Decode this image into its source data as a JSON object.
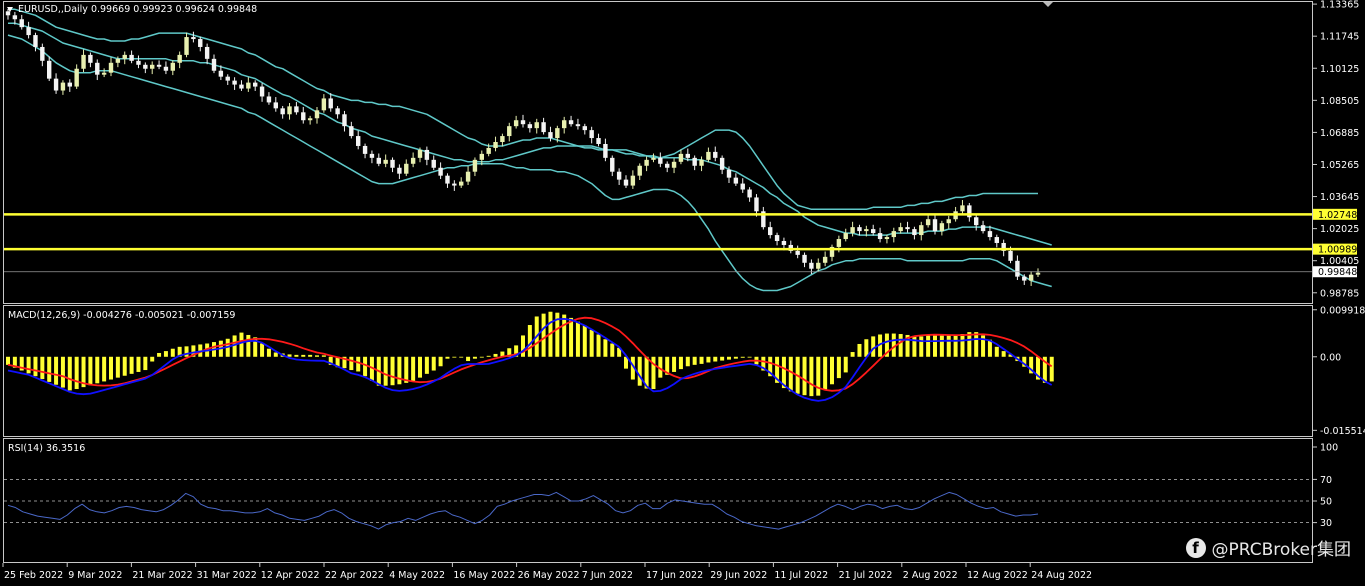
{
  "header": {
    "symbol_line": "EURUSD,,Daily  0.99669 0.99923 0.99624 0.99848"
  },
  "colors": {
    "background": "#000000",
    "frame": "#c8c8c8",
    "bull_candle": "#e8f0b0",
    "bear_candle": "#f4f4f4",
    "bollinger": "#5fc8c8",
    "level_line": "#ffff33",
    "macd_hist": "#ffff33",
    "macd_main": "#1010ff",
    "macd_signal": "#ff1a1a",
    "rsi_line": "#4a68c8"
  },
  "watermark": {
    "icon": "facebook-icon",
    "text": "@PRCBroker集团"
  },
  "chart_data": [
    {
      "type": "candlestick",
      "title": "EURUSD,,Daily",
      "indicators": [
        "Bollinger Bands"
      ],
      "last_ohlc": {
        "open": 0.99669,
        "high": 0.99923,
        "low": 0.99624,
        "close": 0.99848
      },
      "y_ticks": [
        "1.13365",
        "1.11745",
        "1.10125",
        "1.08505",
        "1.06885",
        "1.05265",
        "1.03645",
        "1.02025",
        "1.00405",
        "0.98785"
      ],
      "ylim": [
        0.9837,
        1.1337
      ],
      "x_tick_labels": [
        "25 Feb 2022",
        "9 Mar 2022",
        "21 Mar 2022",
        "31 Mar 2022",
        "12 Apr 2022",
        "22 Apr 2022",
        "4 May 2022",
        "16 May 2022",
        "26 May 2022",
        "7 Jun 2022",
        "17 Jun 2022",
        "29 Jun 2022",
        "11 Jul 2022",
        "21 Jul 2022",
        "2 Aug 2022",
        "12 Aug 2022",
        "24 Aug 2022"
      ],
      "horizontal_levels": [
        {
          "value": 1.02748,
          "label": "1.02748"
        },
        {
          "value": 1.00989,
          "label": "1.00989"
        }
      ],
      "current_price": {
        "value": 0.99848,
        "label": "0.99848"
      },
      "closes": [
        1.128,
        1.126,
        1.122,
        1.118,
        1.112,
        1.105,
        1.096,
        1.09,
        1.094,
        1.092,
        1.101,
        1.108,
        1.104,
        1.098,
        1.099,
        1.104,
        1.106,
        1.108,
        1.105,
        1.103,
        1.101,
        1.103,
        1.102,
        1.1,
        1.104,
        1.108,
        1.117,
        1.116,
        1.112,
        1.106,
        1.1,
        1.097,
        1.095,
        1.093,
        1.091,
        1.094,
        1.092,
        1.087,
        1.084,
        1.081,
        1.078,
        1.082,
        1.079,
        1.075,
        1.076,
        1.08,
        1.086,
        1.081,
        1.078,
        1.072,
        1.067,
        1.062,
        1.058,
        1.056,
        1.053,
        1.055,
        1.051,
        1.048,
        1.053,
        1.056,
        1.06,
        1.055,
        1.051,
        1.047,
        1.043,
        1.042,
        1.044,
        1.049,
        1.055,
        1.058,
        1.061,
        1.064,
        1.067,
        1.072,
        1.075,
        1.073,
        1.071,
        1.074,
        1.069,
        1.066,
        1.071,
        1.075,
        1.073,
        1.072,
        1.07,
        1.066,
        1.063,
        1.056,
        1.049,
        1.045,
        1.042,
        1.047,
        1.052,
        1.055,
        1.056,
        1.053,
        1.051,
        1.054,
        1.058,
        1.056,
        1.052,
        1.055,
        1.059,
        1.056,
        1.05,
        1.046,
        1.043,
        1.04,
        1.036,
        1.029,
        1.021,
        1.017,
        1.014,
        1.012,
        1.009,
        1.007,
        1.003,
        1.0,
        1.003,
        1.006,
        1.011,
        1.015,
        1.018,
        1.021,
        1.019,
        1.02,
        1.018,
        1.015,
        1.016,
        1.019,
        1.021,
        1.02,
        1.017,
        1.022,
        1.025,
        1.019,
        1.023,
        1.025,
        1.029,
        1.032,
        1.026,
        1.022,
        1.019,
        1.016,
        1.013,
        1.009,
        1.004,
        0.996,
        0.994,
        0.997,
        0.998
      ],
      "bollinger": {
        "upper": [
          1.131,
          1.131,
          1.13,
          1.129,
          1.128,
          1.126,
          1.124,
          1.122,
          1.121,
          1.12,
          1.119,
          1.118,
          1.117,
          1.116,
          1.116,
          1.115,
          1.115,
          1.115,
          1.116,
          1.116,
          1.117,
          1.118,
          1.119,
          1.119,
          1.119,
          1.119,
          1.119,
          1.118,
          1.117,
          1.116,
          1.115,
          1.114,
          1.113,
          1.112,
          1.111,
          1.109,
          1.108,
          1.106,
          1.104,
          1.102,
          1.101,
          1.099,
          1.097,
          1.095,
          1.093,
          1.091,
          1.09,
          1.088,
          1.087,
          1.086,
          1.085,
          1.085,
          1.084,
          1.084,
          1.083,
          1.083,
          1.082,
          1.082,
          1.081,
          1.08,
          1.079,
          1.078,
          1.076,
          1.074,
          1.072,
          1.07,
          1.068,
          1.066,
          1.065,
          1.063,
          1.062,
          1.062,
          1.062,
          1.063,
          1.064,
          1.065,
          1.065,
          1.066,
          1.066,
          1.066,
          1.065,
          1.064,
          1.063,
          1.062,
          1.061,
          1.061,
          1.06,
          1.06,
          1.06,
          1.06,
          1.06,
          1.059,
          1.058,
          1.057,
          1.056,
          1.056,
          1.057,
          1.058,
          1.06,
          1.062,
          1.064,
          1.066,
          1.068,
          1.07,
          1.07,
          1.07,
          1.069,
          1.066,
          1.062,
          1.057,
          1.052,
          1.047,
          1.042,
          1.038,
          1.035,
          1.032,
          1.031,
          1.03,
          1.03,
          1.03,
          1.03,
          1.03,
          1.03,
          1.03,
          1.03,
          1.03,
          1.031,
          1.031,
          1.031,
          1.031,
          1.031,
          1.032,
          1.032,
          1.033,
          1.033,
          1.034,
          1.034,
          1.035,
          1.036,
          1.036,
          1.037,
          1.037,
          1.038,
          1.038,
          1.038,
          1.038,
          1.038,
          1.038,
          1.038,
          1.038,
          1.038
        ],
        "middle": [
          1.124,
          1.124,
          1.123,
          1.122,
          1.121,
          1.12,
          1.118,
          1.116,
          1.114,
          1.113,
          1.112,
          1.111,
          1.11,
          1.109,
          1.108,
          1.107,
          1.106,
          1.106,
          1.106,
          1.106,
          1.106,
          1.106,
          1.106,
          1.106,
          1.105,
          1.105,
          1.105,
          1.105,
          1.104,
          1.104,
          1.103,
          1.102,
          1.101,
          1.1,
          1.098,
          1.097,
          1.096,
          1.094,
          1.092,
          1.09,
          1.088,
          1.087,
          1.085,
          1.083,
          1.081,
          1.079,
          1.078,
          1.076,
          1.074,
          1.073,
          1.071,
          1.07,
          1.069,
          1.067,
          1.066,
          1.065,
          1.064,
          1.063,
          1.062,
          1.061,
          1.06,
          1.059,
          1.058,
          1.057,
          1.056,
          1.055,
          1.055,
          1.054,
          1.054,
          1.054,
          1.054,
          1.055,
          1.055,
          1.056,
          1.057,
          1.058,
          1.059,
          1.06,
          1.061,
          1.061,
          1.062,
          1.062,
          1.062,
          1.062,
          1.062,
          1.062,
          1.061,
          1.06,
          1.06,
          1.059,
          1.058,
          1.058,
          1.057,
          1.057,
          1.057,
          1.056,
          1.056,
          1.056,
          1.056,
          1.055,
          1.055,
          1.055,
          1.054,
          1.053,
          1.052,
          1.05,
          1.049,
          1.047,
          1.045,
          1.043,
          1.041,
          1.038,
          1.036,
          1.033,
          1.031,
          1.029,
          1.026,
          1.024,
          1.022,
          1.021,
          1.02,
          1.019,
          1.018,
          1.018,
          1.017,
          1.017,
          1.017,
          1.017,
          1.017,
          1.018,
          1.018,
          1.018,
          1.018,
          1.018,
          1.019,
          1.019,
          1.019,
          1.02,
          1.02,
          1.021,
          1.021,
          1.021,
          1.021,
          1.021,
          1.02,
          1.019,
          1.018,
          1.017,
          1.016,
          1.015,
          1.014,
          1.013,
          1.012
        ],
        "lower": [
          1.118,
          1.117,
          1.116,
          1.114,
          1.112,
          1.11,
          1.107,
          1.104,
          1.102,
          1.1,
          1.099,
          1.099,
          1.099,
          1.1,
          1.1,
          1.1,
          1.099,
          1.098,
          1.097,
          1.096,
          1.095,
          1.094,
          1.093,
          1.092,
          1.091,
          1.09,
          1.089,
          1.088,
          1.087,
          1.086,
          1.085,
          1.084,
          1.083,
          1.082,
          1.081,
          1.079,
          1.078,
          1.076,
          1.074,
          1.072,
          1.07,
          1.068,
          1.066,
          1.064,
          1.062,
          1.06,
          1.058,
          1.056,
          1.054,
          1.052,
          1.05,
          1.048,
          1.046,
          1.044,
          1.043,
          1.043,
          1.043,
          1.044,
          1.045,
          1.046,
          1.047,
          1.048,
          1.049,
          1.05,
          1.051,
          1.051,
          1.052,
          1.052,
          1.053,
          1.053,
          1.053,
          1.053,
          1.053,
          1.052,
          1.051,
          1.051,
          1.05,
          1.05,
          1.05,
          1.05,
          1.049,
          1.049,
          1.048,
          1.047,
          1.045,
          1.043,
          1.04,
          1.037,
          1.035,
          1.035,
          1.036,
          1.037,
          1.038,
          1.039,
          1.04,
          1.04,
          1.04,
          1.039,
          1.037,
          1.034,
          1.03,
          1.025,
          1.02,
          1.014,
          1.009,
          1.004,
          0.999,
          0.995,
          0.992,
          0.99,
          0.989,
          0.989,
          0.989,
          0.99,
          0.991,
          0.993,
          0.995,
          0.997,
          0.999,
          1.0,
          1.002,
          1.003,
          1.004,
          1.004,
          1.005,
          1.005,
          1.005,
          1.005,
          1.005,
          1.005,
          1.005,
          1.004,
          1.004,
          1.004,
          1.004,
          1.004,
          1.004,
          1.004,
          1.004,
          1.004,
          1.005,
          1.005,
          1.005,
          1.005,
          1.004,
          1.002,
          1.0,
          0.998,
          0.996,
          0.994,
          0.993,
          0.992,
          0.991
        ]
      }
    },
    {
      "type": "macd",
      "title": "MACD(12,26,9)",
      "values_line": "MACD(12,26,9) -0.004276 -0.005021 -0.007159",
      "y_ticks": [
        "0.009918",
        "0.00",
        "-0.015514"
      ],
      "ylim": [
        -0.0165,
        0.0105
      ],
      "histogram": [
        -0.0017,
        -0.0023,
        -0.0029,
        -0.0035,
        -0.0041,
        -0.0047,
        -0.0053,
        -0.0059,
        -0.0065,
        -0.0071,
        -0.0068,
        -0.0064,
        -0.006,
        -0.0056,
        -0.0052,
        -0.0048,
        -0.0044,
        -0.004,
        -0.0036,
        -0.0032,
        -0.0028,
        -0.001,
        0.0008,
        0.0012,
        0.0017,
        0.0021,
        0.0022,
        0.0024,
        0.0026,
        0.0028,
        0.0031,
        0.0034,
        0.0038,
        0.0045,
        0.0051,
        0.0046,
        0.0041,
        0.0028,
        0.0017,
        0.0009,
        0.0007,
        0.0005,
        0.0004,
        0.0004,
        0.0004,
        0.0003,
        0.0003,
        -0.0017,
        -0.0022,
        -0.0024,
        -0.0028,
        -0.0031,
        -0.0041,
        -0.0051,
        -0.0061,
        -0.0061,
        -0.006,
        -0.0058,
        -0.0055,
        -0.0051,
        -0.0044,
        -0.0036,
        -0.0029,
        -0.002,
        -0.0004,
        0.0,
        0.0,
        -0.0009,
        -0.0004,
        -0.0001,
        0.0002,
        0.0006,
        0.0011,
        0.0018,
        0.0024,
        0.0045,
        0.0067,
        0.0085,
        0.0091,
        0.0095,
        0.0093,
        0.0089,
        0.0082,
        0.0074,
        0.0066,
        0.0057,
        0.0047,
        0.0037,
        0.0028,
        0.0019,
        -0.0025,
        -0.0048,
        -0.0061,
        -0.0067,
        -0.0068,
        -0.0044,
        -0.0038,
        -0.0032,
        -0.0026,
        -0.002,
        -0.0017,
        -0.0015,
        -0.0012,
        -0.001,
        -0.0008,
        -0.0006,
        -0.0004,
        -0.0002,
        0.0,
        -0.0016,
        -0.0029,
        -0.0041,
        -0.0055,
        -0.0066,
        -0.0073,
        -0.0078,
        -0.0081,
        -0.0083,
        -0.0082,
        -0.007,
        -0.0058,
        -0.0045,
        -0.0033,
        0.001,
        0.0027,
        0.0037,
        0.0043,
        0.0047,
        0.0049,
        0.0049,
        0.0048,
        0.0046,
        0.0044,
        0.0043,
        0.0047,
        0.0046,
        0.0046,
        0.0045,
        0.0046,
        0.0048,
        0.0052,
        0.0052,
        0.0045,
        0.0036,
        0.0021,
        0.0012,
        0.0005,
        -0.0009,
        -0.0021,
        -0.0035,
        -0.0048,
        -0.0055,
        -0.0052
      ]
    },
    {
      "type": "line",
      "title": "RSI(14)",
      "values_line": "RSI(14) 36.3516",
      "y_ticks": [
        "100",
        "70",
        "50",
        "30"
      ],
      "ylim": [
        0,
        100
      ],
      "dashed_levels": [
        70,
        50,
        30
      ],
      "values": [
        46,
        44,
        40,
        38,
        36,
        35,
        34,
        33,
        37,
        43,
        47,
        42,
        40,
        39,
        41,
        44,
        45,
        44,
        42,
        41,
        40,
        42,
        46,
        51,
        57,
        54,
        47,
        44,
        43,
        41,
        41,
        40,
        39,
        39,
        40,
        43,
        39,
        37,
        34,
        33,
        32,
        34,
        36,
        40,
        42,
        39,
        34,
        31,
        29,
        27,
        24,
        28,
        30,
        31,
        34,
        32,
        35,
        38,
        40,
        41,
        37,
        35,
        32,
        29,
        32,
        37,
        45,
        47,
        50,
        52,
        54,
        56,
        56,
        55,
        58,
        54,
        50,
        50,
        52,
        55,
        51,
        47,
        41,
        39,
        41,
        46,
        48,
        43,
        43,
        48,
        51,
        50,
        49,
        48,
        47,
        47,
        43,
        38,
        35,
        31,
        29,
        27,
        26,
        25,
        24,
        26,
        28,
        30,
        33,
        36,
        40,
        44,
        47,
        45,
        42,
        45,
        47,
        46,
        43,
        45,
        46,
        43,
        42,
        44,
        48,
        52,
        55,
        58,
        56,
        52,
        48,
        45,
        43,
        44,
        40,
        38,
        36,
        37,
        37,
        38
      ],
      "last_value": 36.3516
    }
  ]
}
